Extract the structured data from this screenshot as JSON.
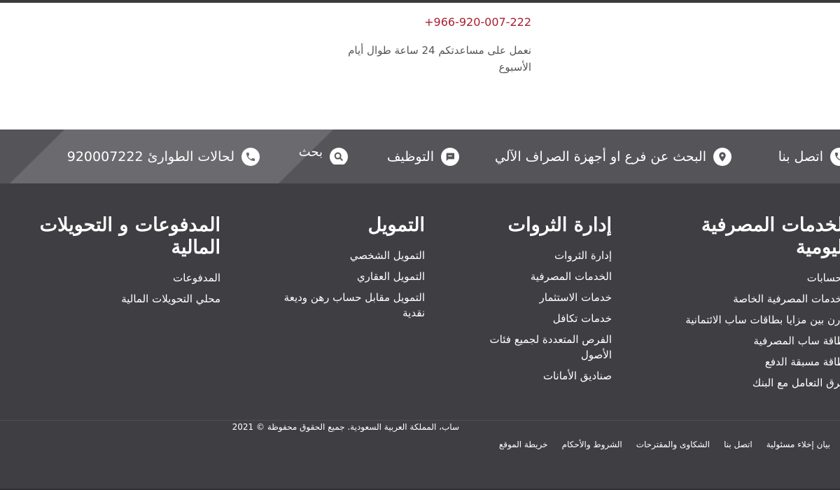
{
  "contact": {
    "phone": "+966-920-007-222",
    "note": "نعمل على مساعدتكم 24 ساعة طوال أيام الأسبوع"
  },
  "quick_links": {
    "contact_us": "اتصل بنا",
    "branch_search": "البحث عن فرع او أجهزة الصراف الآلي",
    "careers": "التوظيف",
    "search": "بحث",
    "emergency": "لحالات الطوارئ 920007222"
  },
  "columns": {
    "daily_banking": {
      "title": "الخدمات المصرفية اليومية",
      "items": [
        "الحسابات",
        "الخدمات المصرفية الخاصة",
        "قارن بين مزايا بطاقات ساب الائتمانية",
        "بطاقة ساب المصرفية",
        "بطاقة مسبقة الدفع",
        "طرق التعامل مع البنك"
      ]
    },
    "wealth": {
      "title": "إدارة الثروات",
      "items": [
        "إدارة الثروات",
        "الخدمات المصرفية",
        "خدمات الاستثمار",
        "خدمات تكافل",
        "الفرص المتعددة لجميع فئات الأصول",
        "صناديق الأمانات"
      ]
    },
    "finance": {
      "title": "التمويل",
      "items": [
        "التمويل الشخصي",
        "التمويل العقاري",
        "التمويل مقابل حساب رهن وديعة نقدية"
      ]
    },
    "payments": {
      "title": "المدفوعات و التحويلات المالية",
      "items": [
        "المدفوعات",
        "محلي التحويلات المالية"
      ]
    }
  },
  "copyright": "ساب، المملكة العربية السعودية. جميع الحقوق محفوظة © 2021",
  "bottom_links": [
    "بيان إخلاء مسئولية",
    "اتصل بنا",
    "الشكاوى والمقترحات",
    "الشروط والأحكام",
    "خريطة الموقع"
  ],
  "colors": {
    "phone_red": "#a8202f",
    "footer_bg": "#3f3f43",
    "bar_bg": "#555559"
  }
}
